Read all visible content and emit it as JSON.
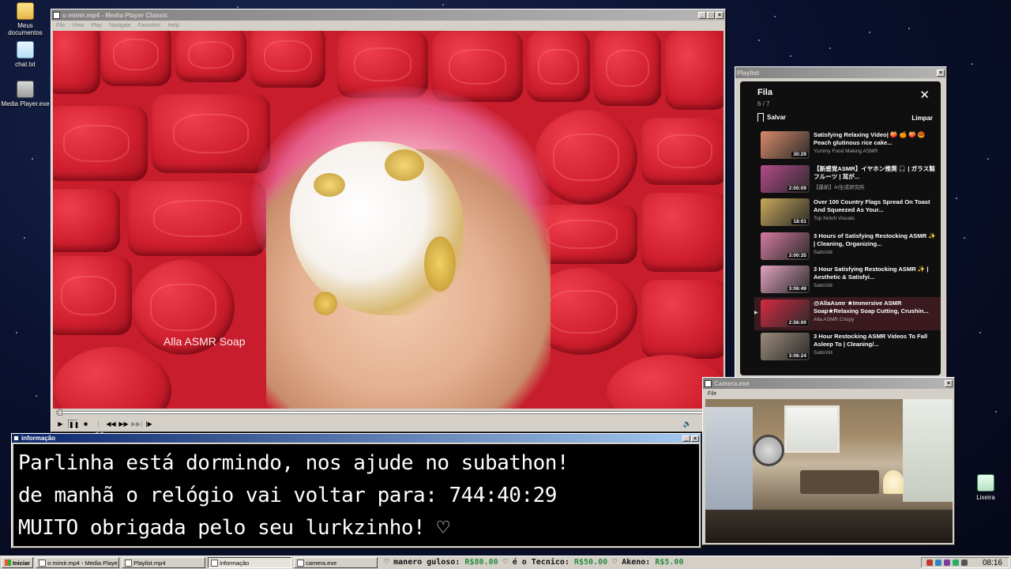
{
  "desktop": {
    "icons": [
      {
        "label": "Meus documentos"
      },
      {
        "label": "chat.txt"
      },
      {
        "label": "Media Player.exe"
      },
      {
        "label": "Lixeira"
      }
    ]
  },
  "mpc": {
    "title": "o mimir.mp4 - Media Player Classic",
    "menu": [
      "File",
      "View",
      "Play",
      "Navigate",
      "Favorites",
      "Help"
    ],
    "watermark": "Alla ASMR Soap",
    "progress": 0.002
  },
  "playlist": {
    "window_title": "Playlist",
    "heading": "Fila",
    "count": "6 / 7",
    "save_label": "Salvar",
    "clear_label": "Limpar",
    "items": [
      {
        "title": "Satisfying Relaxing Video| 🍑 🍊 🍑 🥮 Peach glutinous rice cake...",
        "channel": "Yummy Food Making ASMR",
        "duration": "30:29",
        "thumb_color": "#d98a6a"
      },
      {
        "title": "【新感覚ASMR】イヤホン推奨 🎧 | ガラス製フルーツ | 耳が...",
        "channel": "【最新】AI生成研究所",
        "duration": "2:00:09",
        "thumb_color": "#b44a8a"
      },
      {
        "title": "Over 100 Country Flags Spread On Toast And Squeezed As Your...",
        "channel": "Top Notch Visuals",
        "duration": "18:01",
        "thumb_color": "#c9a85a"
      },
      {
        "title": "3 Hours of Satisfying Restocking ASMR ✨ | Cleaning, Organizing...",
        "channel": "SatisVid",
        "duration": "3:00:35",
        "thumb_color": "#d57aa0"
      },
      {
        "title": "3 Hour Satisfying Restocking ASMR ✨ | Aesthetic & Satisfyi...",
        "channel": "SatisVid",
        "duration": "3:06:49",
        "thumb_color": "#e2a3c0"
      },
      {
        "title": "@AllaAsmr ★Immersive ASMR Soap★Relaxing Soap Cutting, Crushin...",
        "channel": "Alla ASMR Crispy",
        "duration": "2:56:00",
        "thumb_color": "#d62a42",
        "current": true
      },
      {
        "title": "3 Hour Restocking ASMR Videos To Fall Asleep To | Cleaning/...",
        "channel": "SatisVid",
        "duration": "3:06:24",
        "thumb_color": "#9c8c7a"
      }
    ]
  },
  "info": {
    "title": "informação",
    "lines": [
      "Parlinha está dormindo, nos ajude no subathon!",
      "de manhã o relógio vai voltar para:  744:40:29",
      "MUITO obrigada pelo seu lurkzinho! ♡"
    ]
  },
  "camera": {
    "title": "Camera.exe",
    "menu": [
      "File"
    ]
  },
  "taskbar": {
    "start_label": "Iniciar",
    "tasks": [
      {
        "label": "o mimir.mp4 - Media Playe...",
        "active": false
      },
      {
        "label": "Playlist.mp4",
        "active": false
      },
      {
        "label": "informação",
        "active": true
      },
      {
        "label": "camera.exe",
        "active": false
      }
    ],
    "ticker": [
      {
        "name": "manero guloso:",
        "amount": "R$80.00"
      },
      {
        "name": "é o Tecnico:",
        "amount": "R$50.00"
      },
      {
        "name": "Akeno:",
        "amount": "R$5.00"
      }
    ],
    "clock": "08:16"
  }
}
